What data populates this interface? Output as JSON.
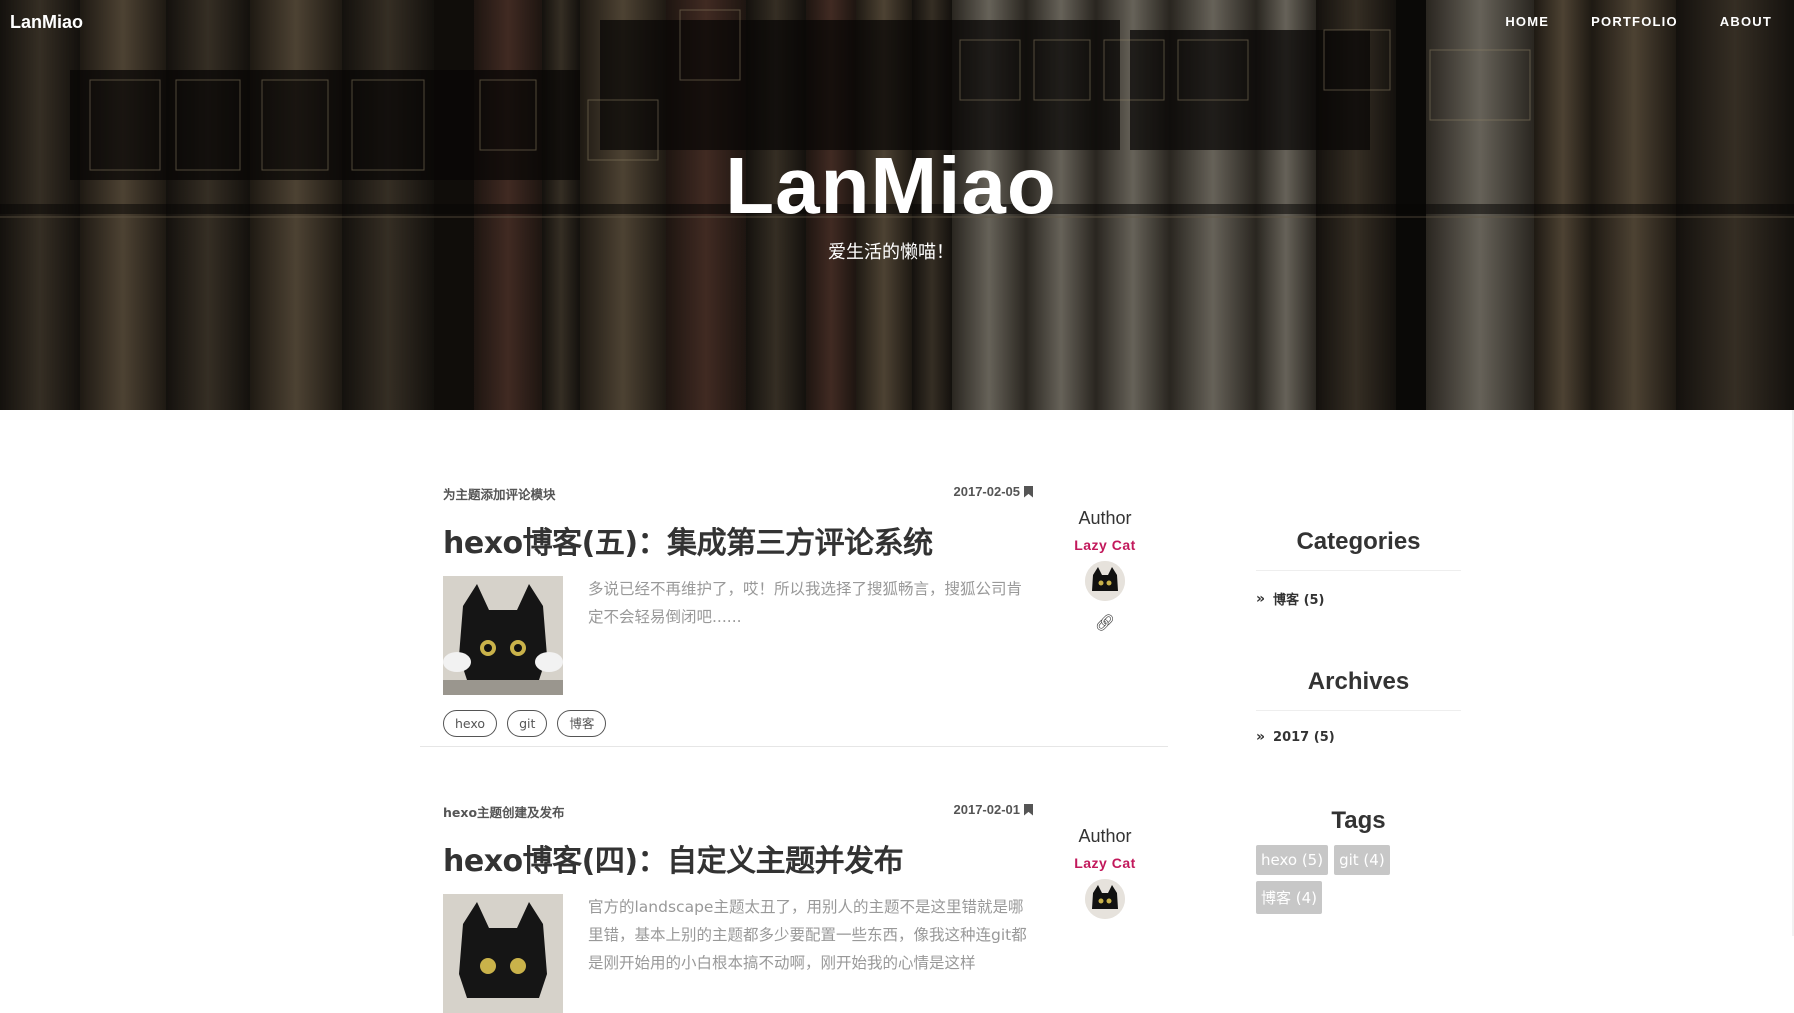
{
  "header": {
    "brand": "LanMiao",
    "nav": [
      "HOME",
      "PORTFOLIO",
      "ABOUT"
    ],
    "title": "LanMiao",
    "subtitle": "爱生活的懒喵！"
  },
  "posts": [
    {
      "subtitle": "为主题添加评论模块",
      "date": "2017-02-05",
      "title": "hexo博客(五)：集成第三方评论系统",
      "excerpt": "多说已经不再维护了，哎！所以我选择了搜狐畅言，搜狐公司肯定不会轻易倒闭吧......",
      "tags": [
        "hexo",
        "git",
        "博客"
      ],
      "author_label": "Author",
      "author_name": "Lazy Cat"
    },
    {
      "subtitle": "hexo主题创建及发布",
      "date": "2017-02-01",
      "title": "hexo博客(四)：自定义主题并发布",
      "excerpt": "官方的landscape主题太丑了，用别人的主题不是这里错就是哪里错，基本上别的主题都多少要配置一些东西，像我这种连git都是刚开始用的小白根本搞不动啊，刚开始我的心情是这样",
      "author_label": "Author",
      "author_name": "Lazy Cat"
    }
  ],
  "sidebar": {
    "categories_title": "Categories",
    "categories": [
      "博客 (5)"
    ],
    "archives_title": "Archives",
    "archives": [
      "2017 (5)"
    ],
    "tags_title": "Tags",
    "tags": [
      "hexo (5)",
      "git (4)",
      "博客 (4)"
    ]
  }
}
